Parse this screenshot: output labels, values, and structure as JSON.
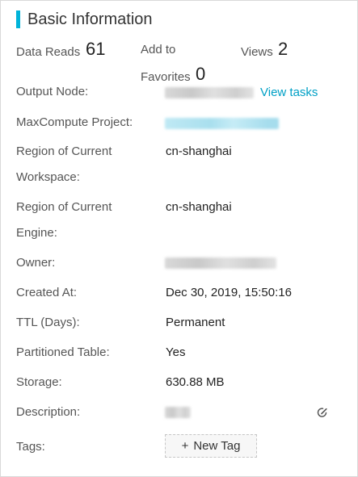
{
  "section": {
    "title": "Basic Information"
  },
  "stats": {
    "data_reads_label": "Data Reads",
    "data_reads_value": "61",
    "favorites_label_line1": "Add to",
    "favorites_label_line2": "Favorites",
    "favorites_value": "0",
    "views_label": "Views",
    "views_value": "2"
  },
  "fields": {
    "output_node": {
      "label": "Output Node:",
      "link": "View tasks"
    },
    "maxcompute_project": {
      "label": "MaxCompute Project:"
    },
    "workspace_region": {
      "label_line1": "Region of Current",
      "label_line2": "Workspace:",
      "value": "cn-shanghai"
    },
    "engine_region": {
      "label_line1": "Region of Current",
      "label_line2": "Engine:",
      "value": "cn-shanghai"
    },
    "owner": {
      "label": "Owner:"
    },
    "created_at": {
      "label": "Created At:",
      "value": "Dec 30, 2019, 15:50:16"
    },
    "ttl": {
      "label": "TTL (Days):",
      "value": "Permanent"
    },
    "partitioned": {
      "label": "Partitioned Table:",
      "value": "Yes"
    },
    "storage": {
      "label": "Storage:",
      "value": "630.88 MB"
    },
    "description": {
      "label": "Description:"
    },
    "tags": {
      "label": "Tags:",
      "button_icon": "+",
      "button_label": "New Tag"
    }
  },
  "colors": {
    "accent": "#00b3d9",
    "link": "#00a0c6"
  },
  "icons": {
    "edit": "edit-icon",
    "add": "plus-icon"
  }
}
